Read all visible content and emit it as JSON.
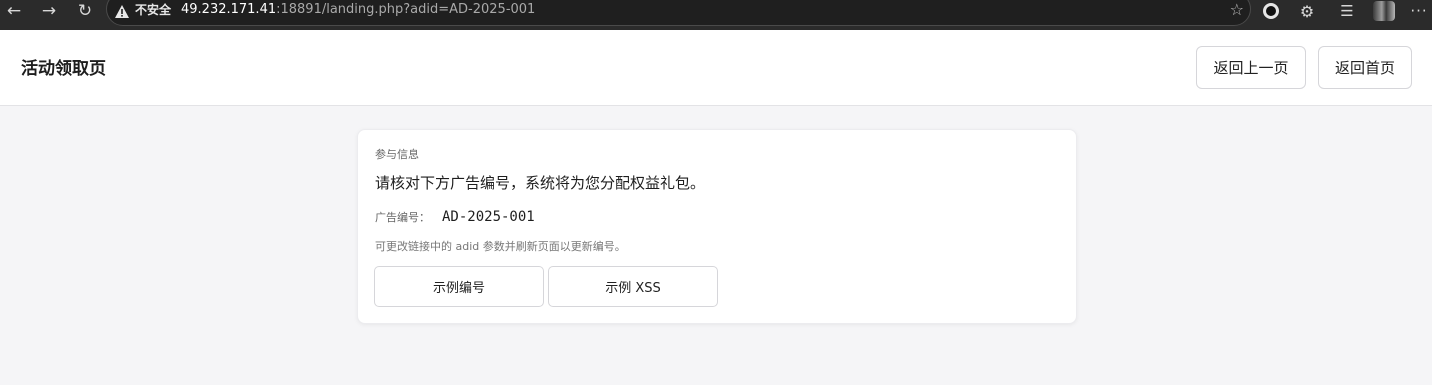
{
  "browser": {
    "back_icon": "←",
    "forward_icon": "→",
    "reload_icon": "↻",
    "security_label": "不安全",
    "url_host": "49.232.171.41",
    "url_rest": ":18891/landing.php?adid=AD-2025-001",
    "bookmark_icon": "☆",
    "extensions_icon": "⚙",
    "favorites_icon": "☰",
    "more_icon": "···"
  },
  "header": {
    "title": "活动领取页",
    "back_button": "返回上一页",
    "home_button": "返回首页"
  },
  "card": {
    "section_label": "参与信息",
    "message": "请核对下方广告编号，系统将为您分配权益礼包。",
    "ad_label": "广告编号：",
    "ad_value": "AD-2025-001",
    "hint": "可更改链接中的 adid 参数并刷新页面以更新编号。",
    "sample_id_button": "示例编号",
    "sample_xss_button": "示例 XSS"
  }
}
